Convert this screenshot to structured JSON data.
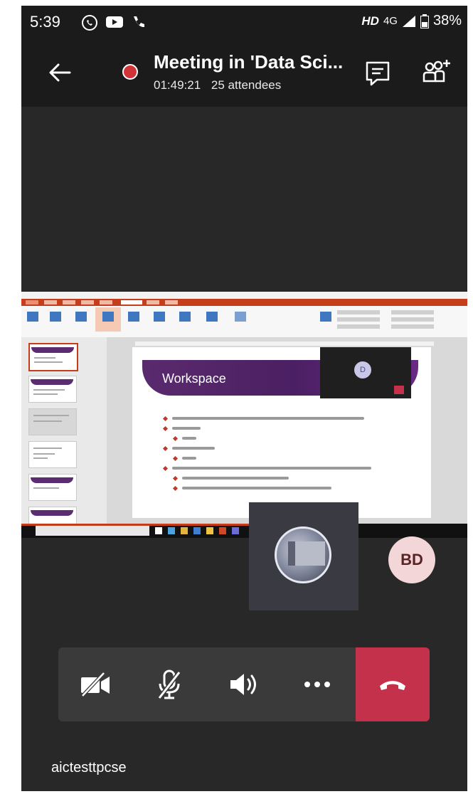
{
  "status_bar": {
    "time": "5:39",
    "hd": "HD",
    "network": "4G",
    "battery": "38%",
    "icons": [
      "whatsapp-icon",
      "youtube-icon",
      "phone-icon",
      "signal-icon",
      "battery-icon"
    ]
  },
  "meeting": {
    "title": "Meeting in 'Data Sci...",
    "duration": "01:49:21",
    "attendees": "25 attendees",
    "recording_color": "#d13438"
  },
  "shared_screen": {
    "slide_title": "Workspace",
    "mini_call_initial": "D"
  },
  "participants": [
    {
      "type": "image-avatar"
    },
    {
      "initials": "BD"
    }
  ],
  "controls": [
    "video-off-icon",
    "mic-off-icon",
    "speaker-icon",
    "more-icon",
    "hang-up-icon"
  ],
  "user": {
    "name": "aictesttpcse"
  },
  "colors": {
    "background": "#282828",
    "header": "#1b1b1b",
    "hangup": "#c4314b",
    "controls_bar": "#3a3a3a",
    "bd_avatar": "#f3d6d8"
  }
}
